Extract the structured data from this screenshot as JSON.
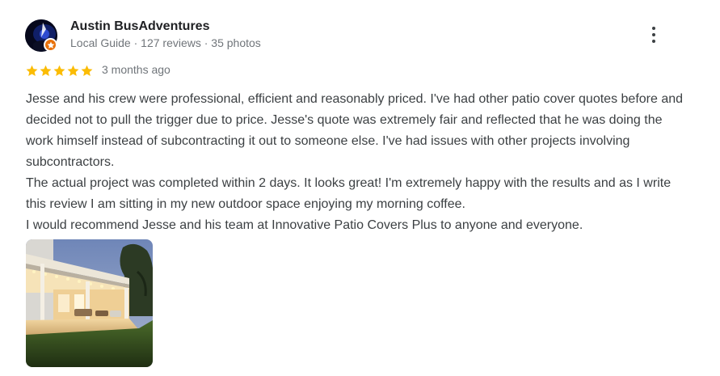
{
  "reviewer": {
    "name": "Austin BusAdventures",
    "meta": "Local Guide · 127 reviews · 35 photos"
  },
  "review": {
    "rating": 5,
    "max_rating": 5,
    "date": "3 months ago",
    "paragraphs": [
      "Jesse and his crew were professional, efficient and reasonably priced. I've had other patio cover quotes before and decided not to pull the trigger due to price. Jesse's quote was extremely fair and reflected that he was doing the work himself instead of subcontracting it out to someone else. I've had issues with other projects involving subcontractors.",
      "The actual project was completed within 2 days. It looks great! I'm extremely happy with the results and as I write this review I am sitting in my new outdoor space enjoying my morning coffee.",
      "I would recommend Jesse and his team at Innovative Patio Covers Plus to anyone and everyone."
    ]
  },
  "icons": {
    "more": "more-vert-icon",
    "star": "star-icon",
    "badge": "local-guide-badge-icon"
  },
  "colors": {
    "star": "#fbbc04",
    "badge": "#e8710a",
    "name": "#202124",
    "meta": "#70757a",
    "body": "#3c4043"
  }
}
